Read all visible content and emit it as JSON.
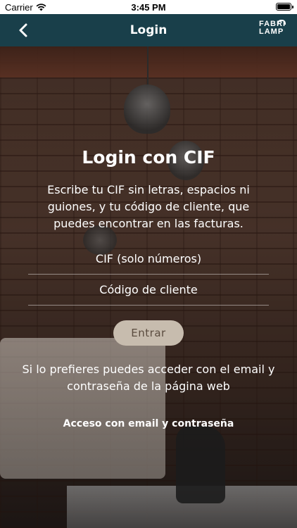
{
  "status_bar": {
    "carrier": "Carrier",
    "time": "3:45 PM"
  },
  "navbar": {
    "title": "Login",
    "back_icon": "chevron-left-icon",
    "logo_line1": "FABRI",
    "logo_line2": "LAMP"
  },
  "login": {
    "heading": "Login con CIF",
    "description": "Escribe tu CIF sin letras, espacios ni guiones, y tu código de cliente, que puedes encontrar en las facturas.",
    "cif_placeholder": "CIF (solo números)",
    "code_placeholder": "Código de cliente",
    "submit_label": "Entrar"
  },
  "alternative": {
    "text": "Si lo prefieres puedes acceder con el email y contraseña de la página web",
    "link_label": "Acceso con email y contraseña"
  },
  "colors": {
    "navbar_bg": "#193f4a",
    "button_bg": "#c7bcae",
    "button_text": "#5b4c3f"
  }
}
